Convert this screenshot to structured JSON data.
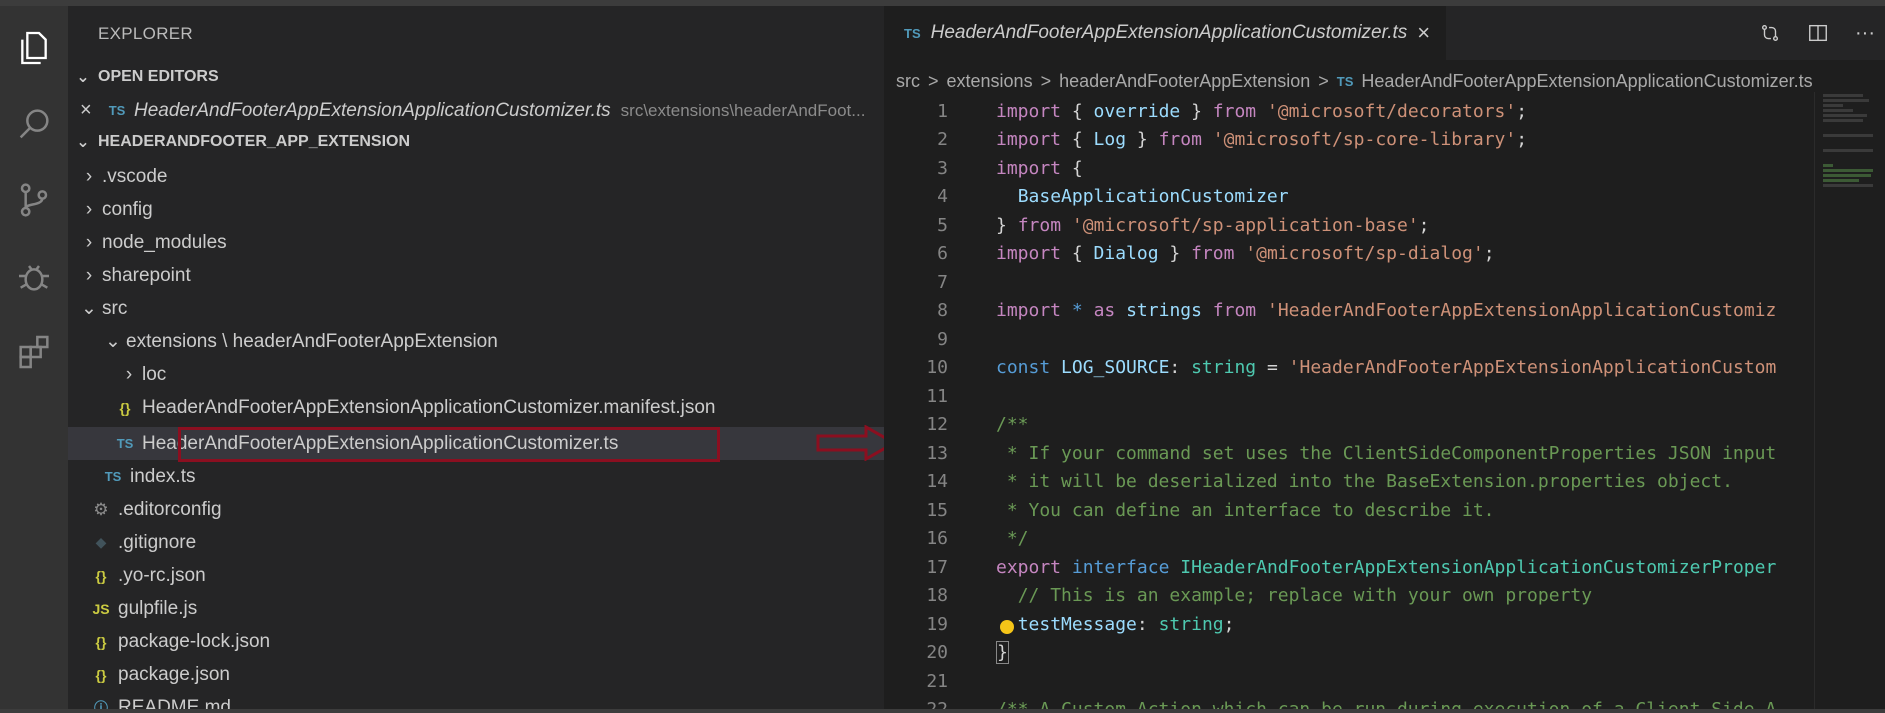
{
  "colors": {
    "accent": "#007acc",
    "highlight_border": "#8b0f20",
    "ts_icon": "#519aba",
    "json_icon": "#cbcb41"
  },
  "activity_bar": {
    "icons": [
      "files-icon",
      "search-icon",
      "source-control-icon",
      "debug-icon",
      "extensions-icon"
    ]
  },
  "sidebar": {
    "title": "EXPLORER",
    "open_editors": {
      "heading": "OPEN EDITORS",
      "items": [
        {
          "icon": "TS",
          "name": "HeaderAndFooterAppExtensionApplicationCustomizer.ts",
          "path": "src\\extensions\\headerAndFoot..."
        }
      ]
    },
    "project": {
      "heading": "HEADERANDFOOTER_APP_EXTENSION",
      "items": [
        {
          "chevron": ">",
          "icon": "",
          "name": ".vscode"
        },
        {
          "chevron": ">",
          "icon": "",
          "name": "config"
        },
        {
          "chevron": ">",
          "icon": "",
          "name": "node_modules"
        },
        {
          "chevron": ">",
          "icon": "",
          "name": "sharepoint"
        },
        {
          "chevron": "v",
          "icon": "",
          "name": "src"
        },
        {
          "chevron": "v",
          "icon": "",
          "name": "extensions \\ headerAndFooterAppExtension"
        },
        {
          "chevron": ">",
          "icon": "",
          "name": "loc"
        },
        {
          "chevron": "",
          "icon": "{}",
          "name": "HeaderAndFooterAppExtensionApplicationCustomizer.manifest.json"
        },
        {
          "chevron": "",
          "icon": "TS",
          "name": "HeaderAndFooterAppExtensionApplicationCustomizer.ts"
        },
        {
          "chevron": "",
          "icon": "TS",
          "name": "index.ts"
        },
        {
          "chevron": "",
          "icon": "⚙",
          "name": ".editorconfig"
        },
        {
          "chevron": "",
          "icon": "◆",
          "name": ".gitignore"
        },
        {
          "chevron": "",
          "icon": "{}",
          "name": ".yo-rc.json"
        },
        {
          "chevron": "",
          "icon": "JS",
          "name": "gulpfile.js"
        },
        {
          "chevron": "",
          "icon": "{}",
          "name": "package-lock.json"
        },
        {
          "chevron": "",
          "icon": "{}",
          "name": "package.json"
        },
        {
          "chevron": "",
          "icon": "ⓘ",
          "name": "README.md"
        }
      ]
    }
  },
  "editor": {
    "tab": {
      "icon": "TS",
      "label": "HeaderAndFooterAppExtensionApplicationCustomizer.ts",
      "close": "×"
    },
    "breadcrumb": [
      "src",
      "extensions",
      "headerAndFooterAppExtension",
      "HeaderAndFooterAppExtensionApplicationCustomizer.ts"
    ],
    "breadcrumb_icon": "TS",
    "breadcrumb_sep": ">",
    "actions": [
      "compare-icon",
      "split-editor-icon",
      "more-icon"
    ],
    "more_label": "···",
    "lines": [
      {
        "n": "1",
        "segs": [
          [
            "k",
            "import"
          ],
          [
            "txt",
            " { "
          ],
          [
            "v",
            "override"
          ],
          [
            "txt",
            " } "
          ],
          [
            "k",
            "from"
          ],
          [
            "txt",
            " "
          ],
          [
            "s",
            "'@microsoft/decorators'"
          ],
          [
            "txt",
            ";"
          ]
        ]
      },
      {
        "n": "2",
        "segs": [
          [
            "k",
            "import"
          ],
          [
            "txt",
            " { "
          ],
          [
            "v",
            "Log"
          ],
          [
            "txt",
            " } "
          ],
          [
            "k",
            "from"
          ],
          [
            "txt",
            " "
          ],
          [
            "s",
            "'@microsoft/sp-core-library'"
          ],
          [
            "txt",
            ";"
          ]
        ]
      },
      {
        "n": "3",
        "segs": [
          [
            "k",
            "import"
          ],
          [
            "txt",
            " {"
          ]
        ]
      },
      {
        "n": "4",
        "segs": [
          [
            "txt",
            "  "
          ],
          [
            "v",
            "BaseApplicationCustomizer"
          ]
        ]
      },
      {
        "n": "5",
        "segs": [
          [
            "txt",
            "} "
          ],
          [
            "k",
            "from"
          ],
          [
            "txt",
            " "
          ],
          [
            "s",
            "'@microsoft/sp-application-base'"
          ],
          [
            "txt",
            ";"
          ]
        ]
      },
      {
        "n": "6",
        "segs": [
          [
            "k",
            "import"
          ],
          [
            "txt",
            " { "
          ],
          [
            "v",
            "Dialog"
          ],
          [
            "txt",
            " } "
          ],
          [
            "k",
            "from"
          ],
          [
            "txt",
            " "
          ],
          [
            "s",
            "'@microsoft/sp-dialog'"
          ],
          [
            "txt",
            ";"
          ]
        ]
      },
      {
        "n": "7",
        "segs": []
      },
      {
        "n": "8",
        "segs": [
          [
            "k",
            "import"
          ],
          [
            "txt",
            " "
          ],
          [
            "kb",
            "*"
          ],
          [
            "txt",
            " "
          ],
          [
            "k",
            "as"
          ],
          [
            "txt",
            " "
          ],
          [
            "v",
            "strings"
          ],
          [
            "txt",
            " "
          ],
          [
            "k",
            "from"
          ],
          [
            "txt",
            " "
          ],
          [
            "s",
            "'HeaderAndFooterAppExtensionApplicationCustomiz"
          ]
        ]
      },
      {
        "n": "9",
        "segs": []
      },
      {
        "n": "10",
        "segs": [
          [
            "kb",
            "const"
          ],
          [
            "txt",
            " "
          ],
          [
            "v",
            "LOG_SOURCE"
          ],
          [
            "txt",
            ": "
          ],
          [
            "t",
            "string"
          ],
          [
            "txt",
            " = "
          ],
          [
            "s",
            "'HeaderAndFooterAppExtensionApplicationCustom"
          ]
        ]
      },
      {
        "n": "11",
        "segs": []
      },
      {
        "n": "12",
        "segs": [
          [
            "c",
            "/**"
          ]
        ]
      },
      {
        "n": "13",
        "segs": [
          [
            "c",
            " * If your command set uses the ClientSideComponentProperties JSON input"
          ]
        ]
      },
      {
        "n": "14",
        "segs": [
          [
            "c",
            " * it will be deserialized into the BaseExtension.properties object."
          ]
        ]
      },
      {
        "n": "15",
        "segs": [
          [
            "c",
            " * You can define an interface to describe it."
          ]
        ]
      },
      {
        "n": "16",
        "segs": [
          [
            "c",
            " */"
          ]
        ]
      },
      {
        "n": "17",
        "segs": [
          [
            "k",
            "export"
          ],
          [
            "txt",
            " "
          ],
          [
            "kb",
            "interface"
          ],
          [
            "txt",
            " "
          ],
          [
            "t",
            "IHeaderAndFooterAppExtensionApplicationCustomizerProper"
          ]
        ]
      },
      {
        "n": "18",
        "segs": [
          [
            "txt",
            "  "
          ],
          [
            "c",
            "// This is an example; replace with your own property"
          ]
        ]
      },
      {
        "n": "19",
        "segs": [
          [
            "txt",
            "  "
          ],
          [
            "v",
            "testMessage"
          ],
          [
            "txt",
            ": "
          ],
          [
            "t",
            "string"
          ],
          [
            "txt",
            ";"
          ]
        ]
      },
      {
        "n": "20",
        "segs": [
          [
            "txt",
            "}"
          ]
        ]
      },
      {
        "n": "21",
        "segs": []
      },
      {
        "n": "22",
        "segs": [
          [
            "c",
            "/** A Custom Action which can be run during execution of a Client Side A"
          ]
        ]
      }
    ]
  }
}
